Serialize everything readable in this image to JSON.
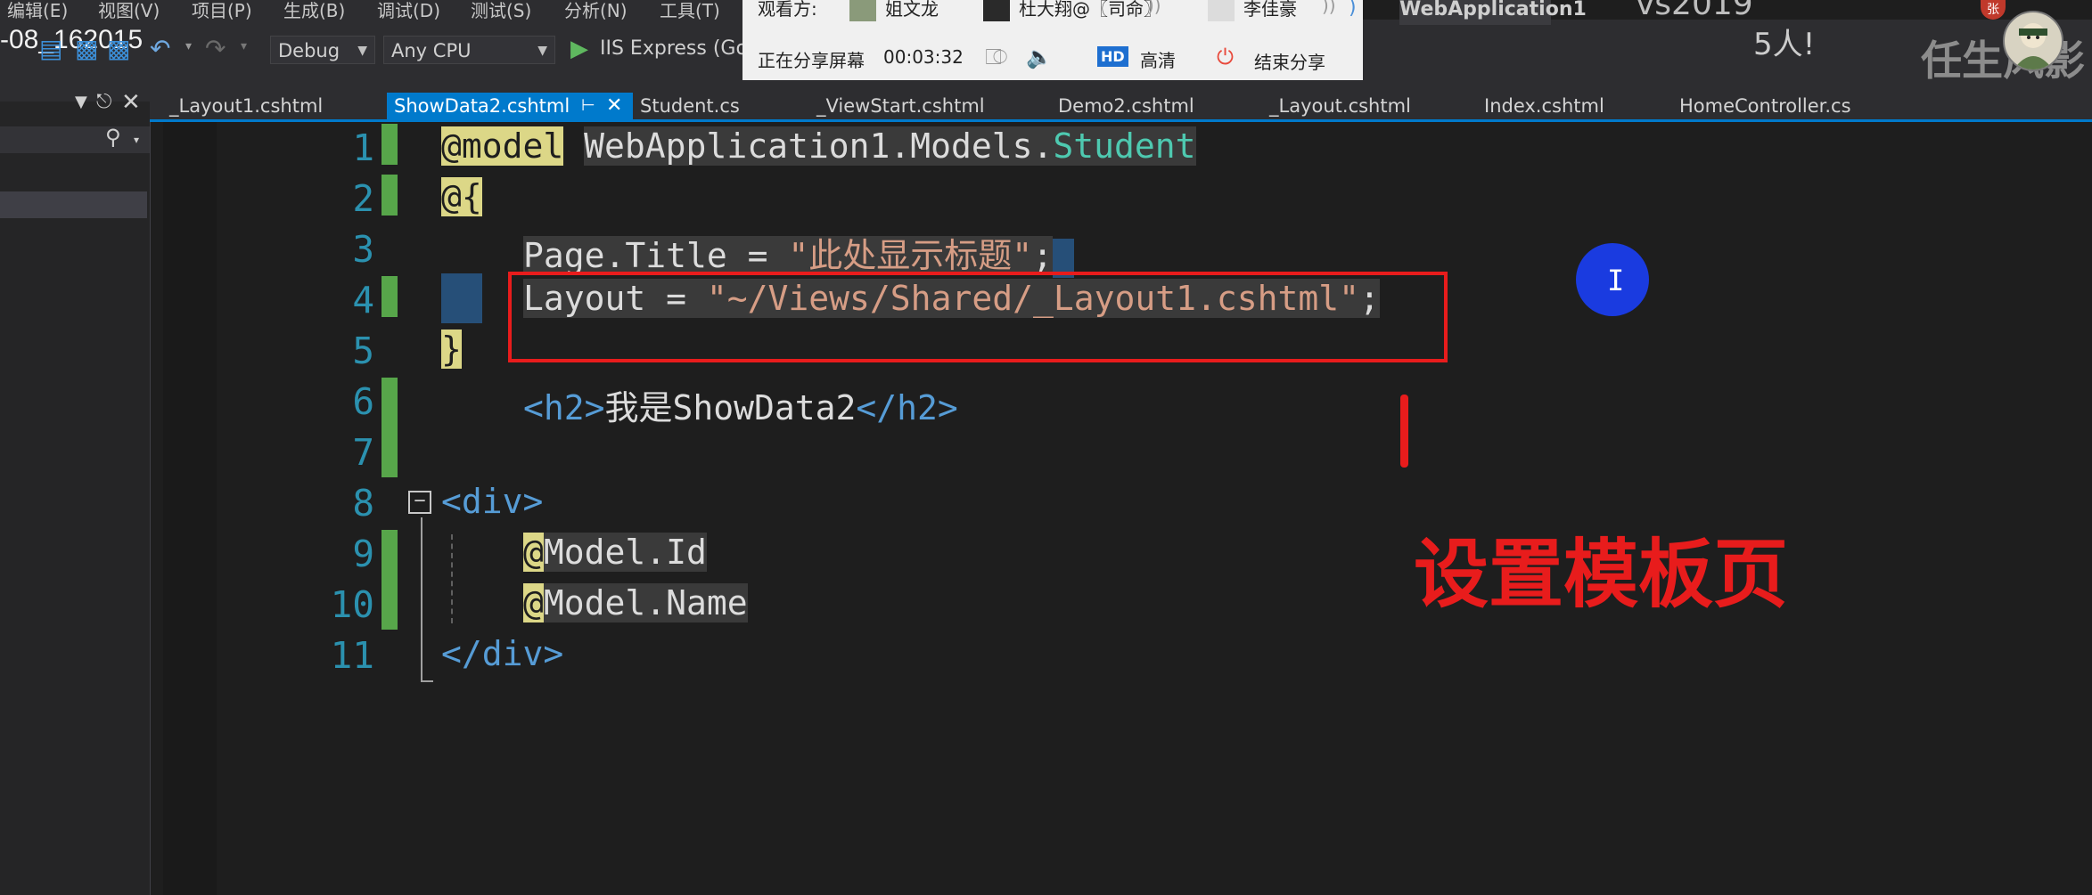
{
  "menu": {
    "items": [
      "编辑(E)",
      "视图(V)",
      "项目(P)",
      "生成(B)",
      "调试(D)",
      "测试(S)",
      "分析(N)",
      "工具(T)"
    ]
  },
  "toolbar": {
    "stamp": "-08_162015",
    "config": "Debug",
    "platform": "Any CPU",
    "run_label": "IIS Express (Goo"
  },
  "share_overlay": {
    "viewers_label": "观看方:",
    "viewer1": "姐文龙",
    "viewer2": "杜大翔@〖司命〗",
    "viewer3": "李佳豪",
    "status": "正在分享屏幕",
    "timer": "00:03:32",
    "hd_badge": "HD",
    "quality": "高清",
    "end_label": "结束分享"
  },
  "window": {
    "app_title": "WebApplication1",
    "vs_version": "vs2019",
    "people_count": "5人!",
    "watermark": "任生风影",
    "avatar_badge": "张"
  },
  "tabs": [
    {
      "label": "_Layout1.cshtml",
      "active": false
    },
    {
      "label": "ShowData2.cshtml",
      "active": true
    },
    {
      "label": "Student.cs",
      "active": false
    },
    {
      "label": "_ViewStart.cshtml",
      "active": false
    },
    {
      "label": "Demo2.cshtml",
      "active": false
    },
    {
      "label": "_Layout.cshtml",
      "active": false
    },
    {
      "label": "Index.cshtml",
      "active": false
    },
    {
      "label": "HomeController.cs",
      "active": false
    }
  ],
  "code": {
    "line_numbers": [
      "1",
      "2",
      "3",
      "4",
      "5",
      "6",
      "7",
      "8",
      "9",
      "10",
      "11"
    ],
    "l1_directive": "@model",
    "l1_ns": "WebApplication1.Models.",
    "l1_class": "Student",
    "l2_open": "@{",
    "l3_prop": "Page.Title = ",
    "l3_str": "\"此处显示标题\"",
    "l3_end": ";",
    "l4_prop": "Layout = ",
    "l4_str": "\"~/Views/Shared/_Layout1.cshtml\"",
    "l4_end": ";",
    "l5_close": "}",
    "l6_open_tag": "<h2>",
    "l6_text": "我是ShowData2",
    "l6_close_tag": "</h2>",
    "l8_open_tag": "<div>",
    "l9_at": "@",
    "l9_text": "Model.Id",
    "l10_at": "@",
    "l10_text": "Model.Name",
    "l11_close_tag": "</div>"
  },
  "annotation": {
    "label": "设置模板页",
    "box_color": "#e81c1c"
  },
  "colors": {
    "editor_bg": "#1e1e1e",
    "accent": "#007acc",
    "line_number": "#2b91af",
    "change_bar": "#57a64a"
  }
}
